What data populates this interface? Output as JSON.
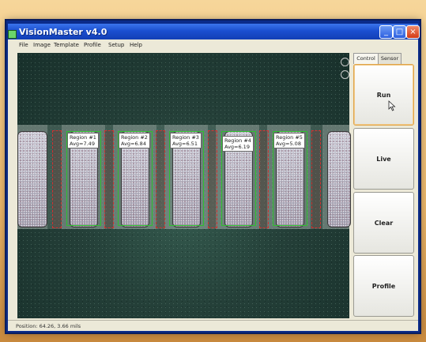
{
  "window": {
    "title": "VisionMaster v4.0",
    "minimize": "_",
    "maximize": "□",
    "close": "×"
  },
  "menu": [
    "File",
    "Image",
    "Template",
    "Profile",
    "Setup",
    "Help"
  ],
  "tabs": [
    "Control",
    "Sensor"
  ],
  "regions": [
    {
      "label": "Region #1",
      "avg": "Avg=7.49"
    },
    {
      "label": "Region #2",
      "avg": "Avg=6.84"
    },
    {
      "label": "Region #3",
      "avg": "Avg=6.51"
    },
    {
      "label": "Region #4",
      "avg": "Avg=6.19"
    },
    {
      "label": "Region #5",
      "avg": "Avg=5.08"
    }
  ],
  "buttons": {
    "run": "Run",
    "live": "Live",
    "clear": "Clear",
    "profile": "Profile"
  },
  "status": "Position: 64.26, 3.66 mils",
  "colors": {
    "titlebar": "#1b4fd0",
    "roi_green": "#2fc02f",
    "roi_red": "#d23030",
    "active_button": "#e0a44a"
  }
}
